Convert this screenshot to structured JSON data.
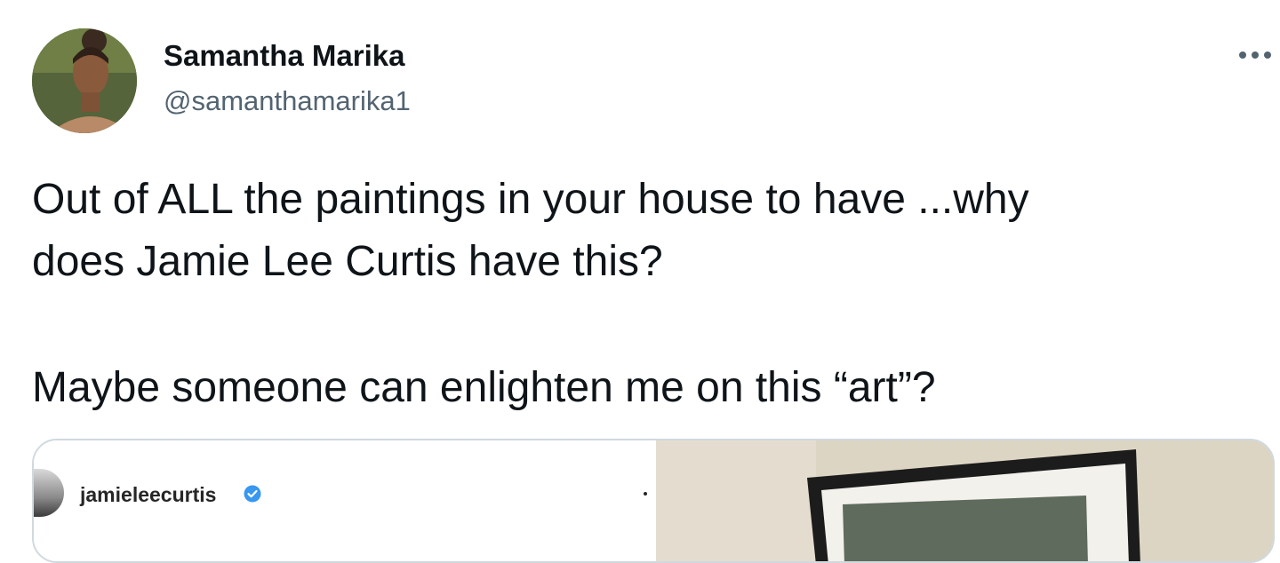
{
  "author": {
    "name": "Samantha Marika",
    "handle": "@samanthamarika1"
  },
  "tweet": {
    "line1": "Out of ALL the paintings in your house to have ...why",
    "line2": "does Jamie Lee Curtis have this?",
    "line3": "Maybe someone can enlighten me on this “art”?"
  },
  "media": {
    "instagram_username": "jamieleecurtis",
    "verified_color": "#3897f0"
  },
  "icons": {
    "more": "more-horizontal-icon",
    "verified": "verified-badge-icon"
  }
}
